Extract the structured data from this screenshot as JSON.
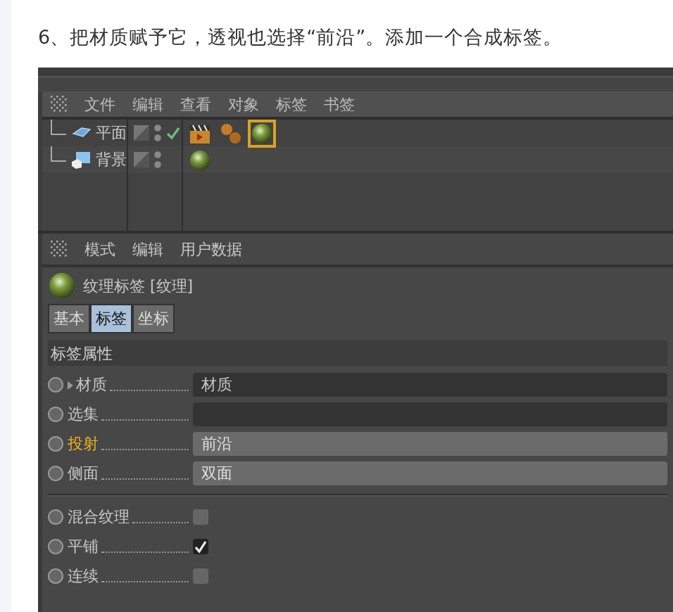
{
  "heading": "6、把材质赋予它，透视也选择“前沿”。添加一个合成标签。",
  "object_manager": {
    "menu": [
      "文件",
      "编辑",
      "查看",
      "对象",
      "标签",
      "书签"
    ],
    "objects": [
      {
        "name": "平面",
        "kind": "plane",
        "checked": true,
        "tags": [
          {
            "kind": "clapper",
            "selected": false
          },
          {
            "kind": "spheres",
            "selected": false
          },
          {
            "kind": "texture",
            "selected": true
          }
        ]
      },
      {
        "name": "背景",
        "kind": "background",
        "checked": false,
        "tags": [
          {
            "kind": "texture",
            "selected": false
          }
        ]
      }
    ]
  },
  "attribute_manager": {
    "menu": [
      "模式",
      "编辑",
      "用户数据"
    ],
    "title": "纹理标签 [纹理]",
    "tabs": [
      {
        "label": "基本",
        "selected": false
      },
      {
        "label": "标签",
        "selected": true
      },
      {
        "label": "坐标",
        "selected": false
      }
    ],
    "section": "标签属性",
    "fields": [
      {
        "kind": "link",
        "label": "材质",
        "value": "材质",
        "expander": true,
        "highlighted": false,
        "keyframed": false
      },
      {
        "kind": "link",
        "label": "选集",
        "expander": false,
        "highlighted": false,
        "keyframed": false
      },
      {
        "kind": "dropdown",
        "label": "投射",
        "value": "前沿",
        "expander": false,
        "highlighted": true,
        "keyframed": false
      },
      {
        "kind": "dropdown",
        "label": "侧面",
        "value": "双面",
        "expander": false,
        "highlighted": false,
        "keyframed": false
      },
      {
        "kind": "divider"
      },
      {
        "kind": "checkbox",
        "label": "混合纹理",
        "checked": false,
        "highlighted": false,
        "keyframed": false
      },
      {
        "kind": "checkbox",
        "label": "平铺",
        "checked": true,
        "highlighted": false,
        "keyframed": false
      },
      {
        "kind": "checkbox",
        "label": "连续",
        "checked": false,
        "highlighted": false,
        "keyframed": false
      }
    ]
  }
}
